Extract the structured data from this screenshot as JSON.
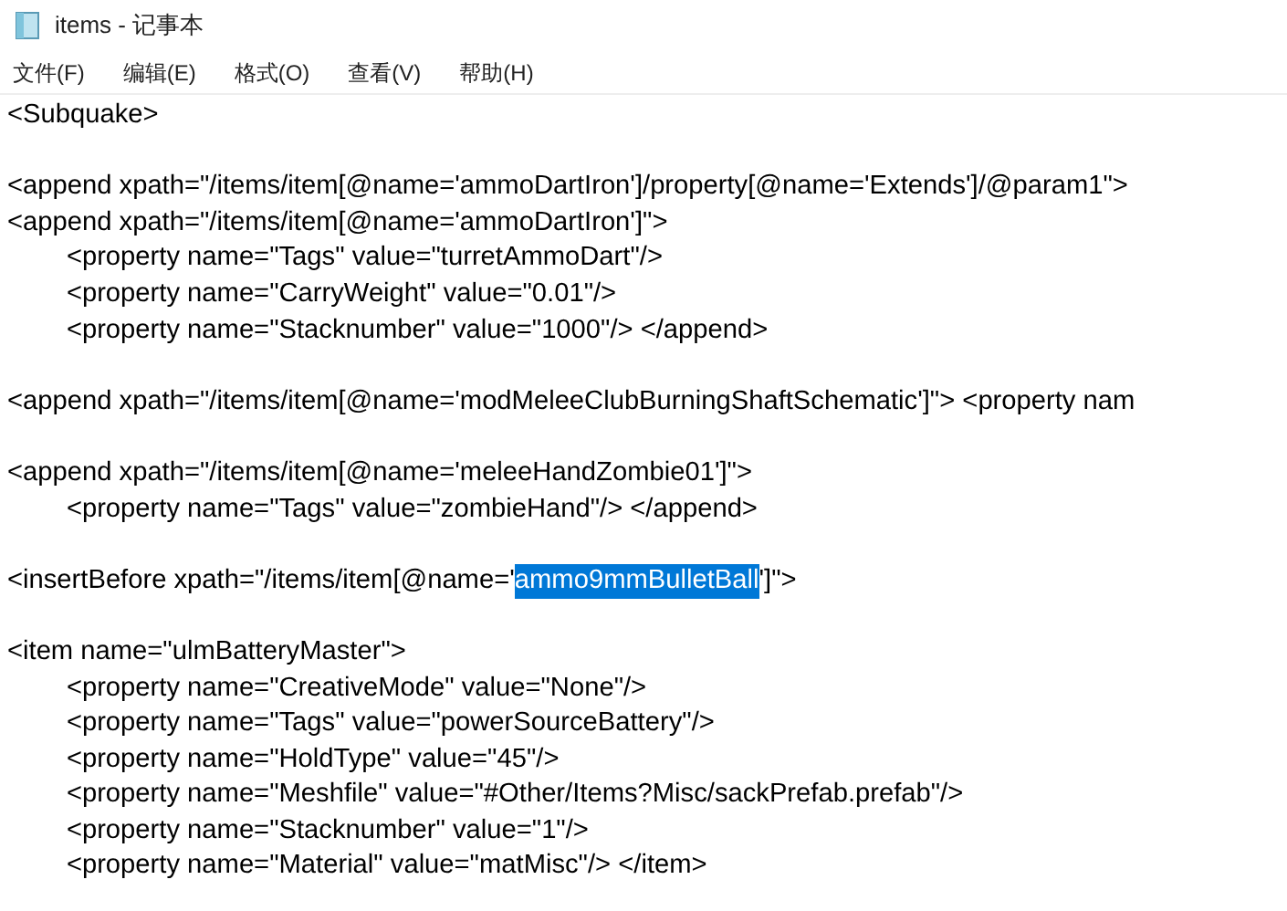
{
  "window": {
    "title": "items - 记事本"
  },
  "menu": [
    {
      "label": "文件(F)"
    },
    {
      "label": "编辑(E)"
    },
    {
      "label": "格式(O)"
    },
    {
      "label": "查看(V)"
    },
    {
      "label": "帮助(H)"
    }
  ],
  "editor": {
    "blocks": [
      [
        {
          "text": "<Subquake>"
        }
      ],
      [
        {
          "text": "<append xpath=\"/items/item[@name='ammoDartIron']/property[@name='Extends']/@param1\">"
        },
        {
          "text": "<append xpath=\"/items/item[@name='ammoDartIron']\">"
        },
        {
          "text": "\t<property name=\"Tags\" value=\"turretAmmoDart\"/>"
        },
        {
          "text": "\t<property name=\"CarryWeight\" value=\"0.01\"/>"
        },
        {
          "text": "\t<property name=\"Stacknumber\" value=\"1000\"/> </append>"
        }
      ],
      [
        {
          "text": "<append xpath=\"/items/item[@name='modMeleeClubBurningShaftSchematic']\"> <property nam"
        }
      ],
      [
        {
          "text": "<append xpath=\"/items/item[@name='meleeHandZombie01']\">"
        },
        {
          "text": "\t<property name=\"Tags\" value=\"zombieHand\"/> </append>"
        }
      ],
      [
        {
          "parts": [
            {
              "text": "<insertBefore xpath=\"/items/item[@name='",
              "selected": false
            },
            {
              "text": "ammo9mmBulletBall",
              "selected": true
            },
            {
              "text": "']\">",
              "selected": false
            }
          ]
        }
      ],
      [
        {
          "text": "<item name=\"ulmBatteryMaster\">"
        },
        {
          "text": "\t<property name=\"CreativeMode\" value=\"None\"/>"
        },
        {
          "text": "\t<property name=\"Tags\" value=\"powerSourceBattery\"/>"
        },
        {
          "text": "\t<property name=\"HoldType\" value=\"45\"/>"
        },
        {
          "text": "\t<property name=\"Meshfile\" value=\"#Other/Items?Misc/sackPrefab.prefab\"/>"
        },
        {
          "text": "\t<property name=\"Stacknumber\" value=\"1\"/>"
        },
        {
          "text": "\t<property name=\"Material\" value=\"matMisc\"/> </item>"
        }
      ]
    ]
  }
}
